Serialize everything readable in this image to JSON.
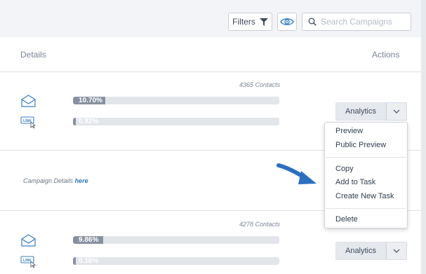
{
  "toolbar": {
    "filters_label": "Filters",
    "search_placeholder": "Search Campaigns"
  },
  "table": {
    "headers": {
      "details": "Details",
      "actions": "Actions"
    }
  },
  "rows": [
    {
      "contacts": "4365 Contacts",
      "open_rate": "10.70%",
      "open_rate_value": 10.7,
      "click_rate": "0.82%",
      "click_rate_value": 0.82,
      "action_label": "Analytics"
    },
    {
      "contacts": "4278 Contacts",
      "open_rate": "9.86%",
      "open_rate_value": 9.86,
      "click_rate": "0.16%",
      "click_rate_value": 0.16,
      "action_label": "Analytics"
    }
  ],
  "campaign_details": {
    "prefix": "Campaign Details",
    "link": "here"
  },
  "menu": {
    "items": [
      "Preview",
      "Public Preview",
      "Copy",
      "Add to Task",
      "Create New Task",
      "Delete"
    ]
  },
  "icons": {
    "filter": "filter-funnel-icon",
    "eye": "eye-icon",
    "search": "search-icon",
    "email_open": "envelope-open-icon",
    "link_click": "link-click-icon",
    "caret": "chevron-down-icon",
    "annotation_arrow": "arrow-annotation-icon"
  },
  "colors": {
    "bar_fill": "#8891a1",
    "bar_track": "#e2e5ea",
    "link": "#2b7bbf",
    "annotation_arrow": "#2a6fc0"
  }
}
